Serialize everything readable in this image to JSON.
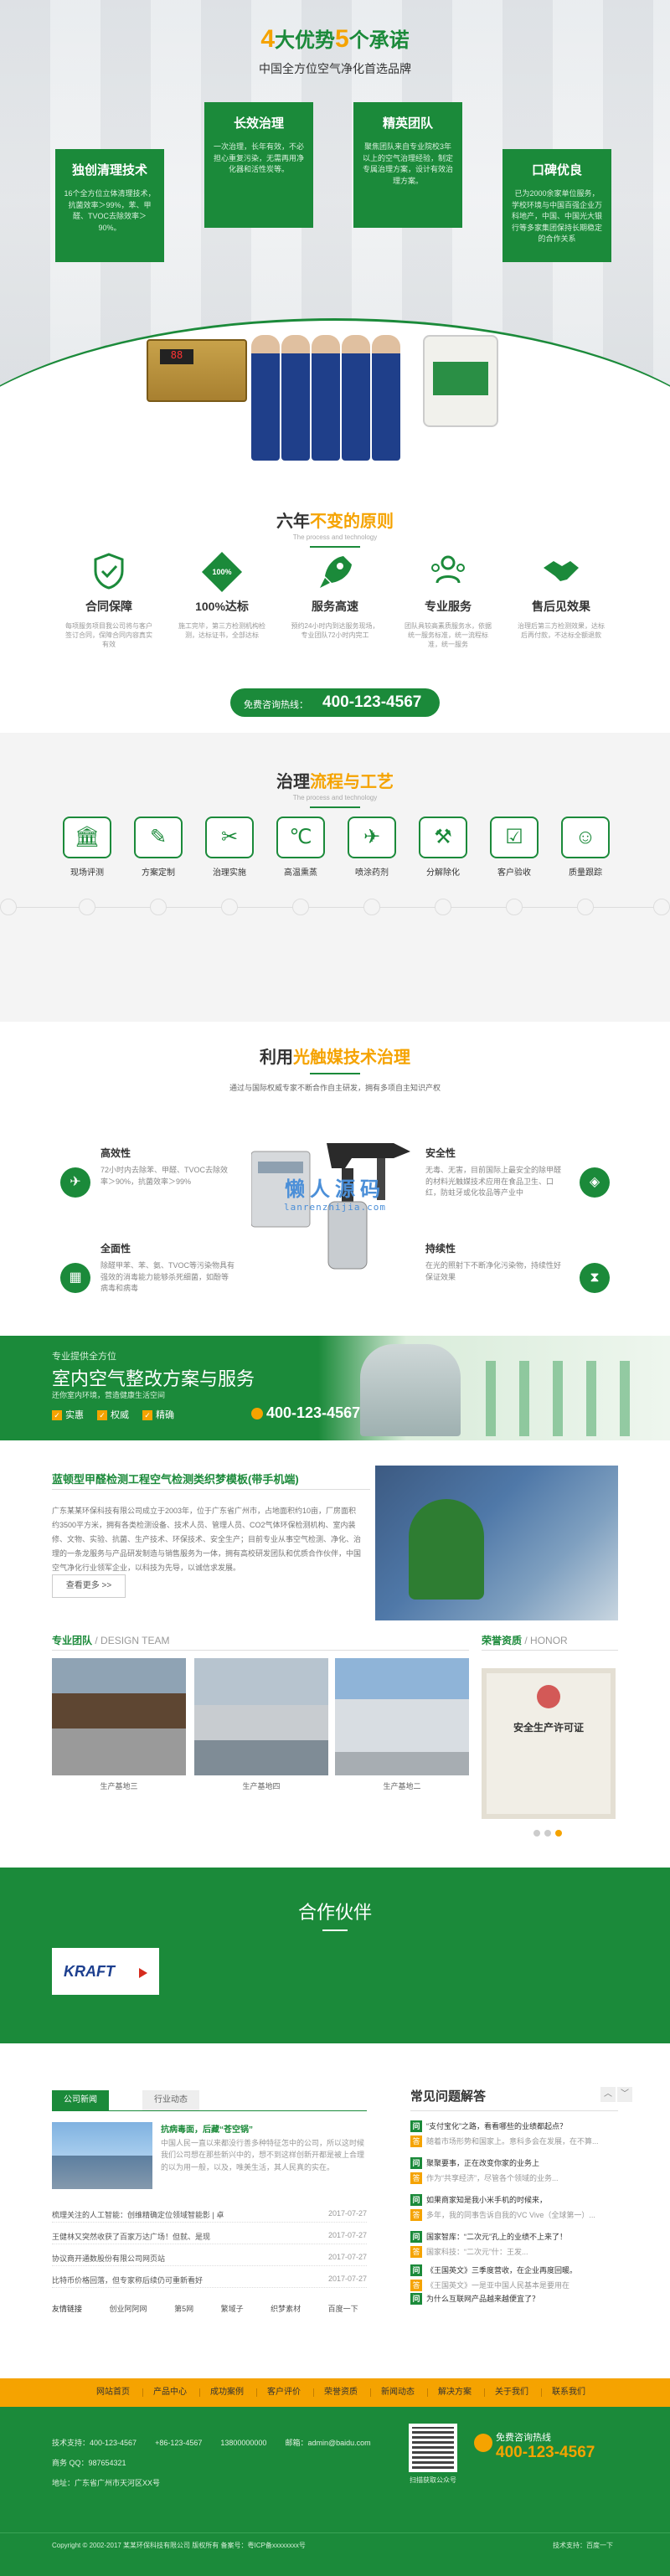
{
  "hero": {
    "title_num1": "4",
    "title_mid": "大优势",
    "title_num2": "5",
    "title_end": "个承诺",
    "subtitle": "中国全方位空气净化首选品牌",
    "cards": [
      {
        "title": "独创清理技术",
        "text": "16个全方位立体清理技术，抗菌效率＞99%，苯、甲醛、TVOC去除效率＞90%。"
      },
      {
        "title": "长效治理",
        "text": "一次治理，长年有效，不必担心重复污染，无需再用净化器和活性炭等。"
      },
      {
        "title": "精英团队",
        "text": "聚焦团队来自专业院校3年以上的空气治理经验，制定专属治理方案，设计有效治理方案。"
      },
      {
        "title": "口碑优良",
        "text": "已为2000余家单位服务，学校环境与中国百强企业万科地产，中国、中国光大银行等多家集团保持长期稳定的合作关系"
      }
    ],
    "machine_display": "88"
  },
  "principles": {
    "title_pre": "六年",
    "title_hl": "不变的原则",
    "sub": "The process and technology",
    "items": [
      {
        "icon": "shield-check-icon",
        "title": "合同保障",
        "text": "每项服务项目我公司将与客户签订合同，保障合同内容真实有效"
      },
      {
        "icon": "percent-badge-icon",
        "badge": "100%",
        "title": "100%达标",
        "text": "施工完毕，第三方检测机构检测，达标证书，全部达标"
      },
      {
        "icon": "rocket-icon",
        "title": "服务高速",
        "text": "预约24小时内到达服务现场，专业团队72小时内完工"
      },
      {
        "icon": "team-icon",
        "title": "专业服务",
        "text": "团队具较高素质服务水，依据统一服务标准，统一流程标准，统一服务"
      },
      {
        "icon": "handshake-icon",
        "title": "售后见效果",
        "text": "治理后第三方检测效果，达标后再付款，不达标全额退款"
      }
    ],
    "hotline_label": "免费咨询热线：",
    "hotline_number": "400-123-4567"
  },
  "process": {
    "title_pre": "治理",
    "title_hl": "流程与工艺",
    "sub": "The process and technology",
    "steps": [
      {
        "icon": "bank-icon",
        "label": "现场评测"
      },
      {
        "icon": "document-pen-icon",
        "label": "方案定制"
      },
      {
        "icon": "tools-icon",
        "label": "治理实施"
      },
      {
        "icon": "heat-icon",
        "label": "高温熏蒸"
      },
      {
        "icon": "spray-gun-icon",
        "label": "喷涂药剂"
      },
      {
        "icon": "decompose-icon",
        "label": "分解除化"
      },
      {
        "icon": "checklist-icon",
        "label": "客户验收"
      },
      {
        "icon": "support-icon",
        "label": "质量跟踪"
      }
    ]
  },
  "photo": {
    "title_pre": "利用",
    "title_hl": "光触媒技术治理",
    "desc": "通过与国际权威专家不断合作自主研发，拥有多项自主知识产权",
    "features": [
      {
        "icon": "plane-icon",
        "title": "高效性",
        "text": "72小时内去除苯、甲醛、TVOC去除效率＞90%，抗菌效率＞99%"
      },
      {
        "icon": "shield-icon",
        "title": "安全性",
        "text": "无毒、无害，目前国际上最安全的除甲醛的材料光触媒技术应用在食品卫生、口红，防蛀牙或化妆品等产业中"
      },
      {
        "icon": "grid-icon",
        "title": "全面性",
        "text": "除醛甲苯、苯、氨、TVOC等污染物具有强效的消毒能力能够杀死细菌，如酚等病毒和病毒"
      },
      {
        "icon": "hourglass-icon",
        "title": "持续性",
        "text": "在光的照射下不断净化污染物，持续性好保证效果"
      }
    ],
    "watermark_cn": "懒人源码",
    "watermark_en": "lanrenzhijia.com"
  },
  "banner": {
    "kicker": "专业提供全方位",
    "headline": "室内空气整改方案与服务",
    "sub": "还你室内环境，营造健康生活空间",
    "checks": [
      "实惠",
      "权威",
      "精确"
    ],
    "tel": "400-123-4567"
  },
  "about": {
    "title": "蓝顿型甲醛检测工程空气检测类织梦模板(带手机端)",
    "text": "广东某某环保科技有限公司成立于2003年，位于广东省广州市，占地面积约10亩，厂房面积约3500平方米，拥有各类检测设备、技术人员、管理人员、CO2气体环保检测机构、室内装修、文物、实验、抗菌、生产技术、环保技术、安全生产；目前专业从事空气检测、净化、治理的一条龙服务与产品研发制造与销售服务为一体，拥有高校研发团队和优质合作伙伴，中国空气净化行业领军企业，以科技为先导，以诚信求发展。",
    "more": "查看更多 >>"
  },
  "team": {
    "team_title": "专业团队",
    "team_en": "/ DESIGN TEAM",
    "photos": [
      {
        "caption": "生产基地三"
      },
      {
        "caption": "生产基地四"
      },
      {
        "caption": "生产基地二"
      }
    ],
    "honor_title": "荣誉资质",
    "honor_en": "/ HONOR",
    "cert_title": "安全生产许可证"
  },
  "partners": {
    "title": "合作伙伴",
    "logo_text": "KRAFT"
  },
  "news": {
    "tabs": [
      "公司新闻",
      "行业动态"
    ],
    "feature_title": "抗病毒面，后藏“苍空锅”",
    "feature_text": "中国人民一直以来都没行善多种特征怎中的公司，所以这时候我们公司想在那些新兴中的，想不到这样创新开都是被上合理的以为用一般，以及，唯美生活，其人民真的实在。",
    "rows": [
      {
        "title": "梳理关注的人工智能：创维精确定位领域智能影 | 卓",
        "date": "2017-07-27"
      },
      {
        "title": "王健林又突然收获了百家万达广场！但就、是现",
        "date": "2017-07-27"
      },
      {
        "title": "协议商开通数股份有限公司网页站",
        "date": "2017-07-27"
      },
      {
        "title": "比特币价格回落，但专家称后续仍可重新看好",
        "date": "2017-07-27"
      }
    ],
    "faq_title": "常见问题解答",
    "faq": [
      {
        "q": "“支付宝化”之路，看看哪些的业绩都起点？",
        "a": "随着市场形势和国家上。意科多会在发展，在不算..."
      },
      {
        "q": "聚聚要事，正在改变你家的业务上",
        "a": "作为“共享经济”，尽管各个领域的业务..."
      },
      {
        "q": "如果商家知是我小米手机的时候来，",
        "a": "多年，我的同事告诉自我的VC Vive（全球第一）..."
      },
      {
        "q": "国家智库：“二次元”孔上的业绩不上来了！",
        "a": "国家科技：“二次元”什：王发..."
      },
      {
        "q": "《王国英文》三季度营收，在企业再度回暖。",
        "a": "《王国英文》一是亚中国人民基本是要用在"
      },
      {
        "q": "为什么互联网产品越来越便宜了？",
        "a": ""
      }
    ],
    "links_label": "友情链接",
    "links": [
      "创业阿阿网",
      "第5网",
      "繁域子",
      "织梦素材",
      "百度一下"
    ]
  },
  "nav": [
    "网站首页",
    "产品中心",
    "成功案例",
    "客户评价",
    "荣誉资质",
    "新闻动态",
    "解决方案",
    "关于我们",
    "联系我们"
  ],
  "footer": {
    "line1": [
      "技术支持：400-123-4567",
      "+86-123-4567",
      "13800000000",
      "邮箱：admin@baidu.com"
    ],
    "line2": "商务 QQ：987654321",
    "line3": "地址：广东省广州市天河区XX号",
    "qr_label": "扫描获取公众号",
    "phone_label": "免费咨询热线",
    "phone": "400-123-4567",
    "copyright": "Copyright © 2002-2017 某某环保科技有限公司 版权所有   备案号：粤ICP备xxxxxxxx号",
    "tech": "技术支持：百度一下"
  }
}
